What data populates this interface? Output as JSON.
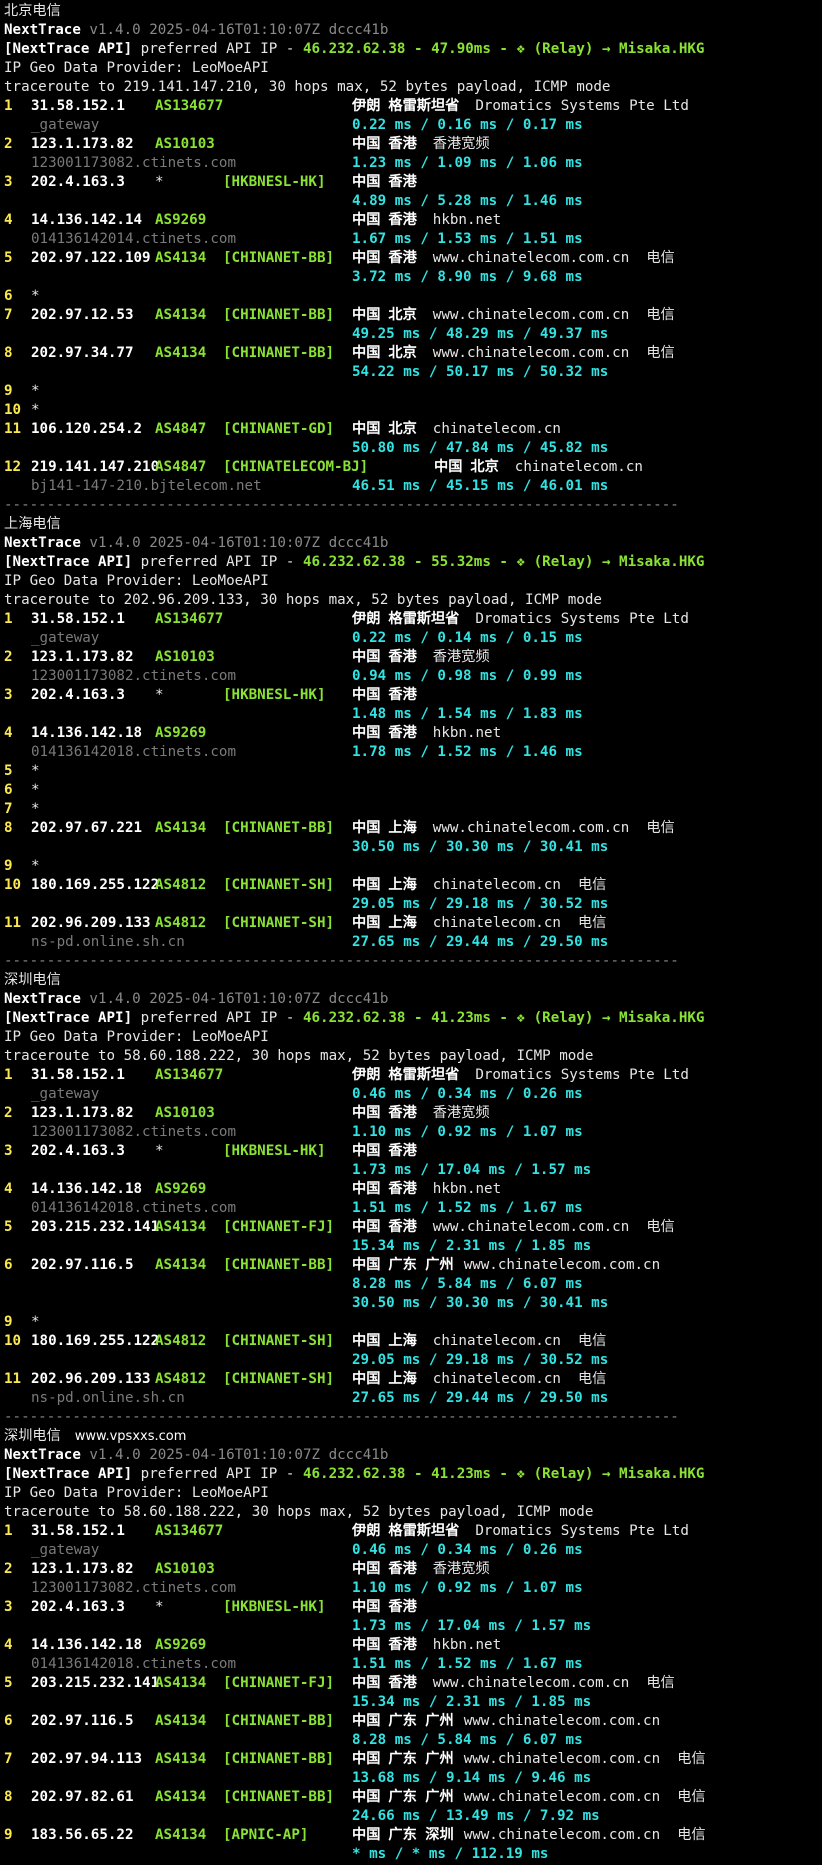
{
  "blocks": [
    {
      "title": "北京电信",
      "version": "v1.4.0 2025-04-16T01:10:07Z dccc41b",
      "api_ip": "46.232.62.38",
      "api_ms": "47.90ms",
      "relay": "(Relay) → Misaka.HKG",
      "geo_provider": "IP Geo Data Provider: LeoMoeAPI",
      "traceroute": "traceroute to 219.141.147.210, 30 hops max, 52 bytes payload, ICMP mode",
      "hops": [
        {
          "n": "1",
          "ip": "31.58.152.1",
          "asn": "AS134677",
          "tag": "",
          "country": "伊朗",
          "region": "格雷斯坦省",
          "org": "Dromatics Systems Pte Ltd",
          "host": "_gateway",
          "rtt": "0.22 ms / 0.16 ms / 0.17 ms"
        },
        {
          "n": "2",
          "ip": "123.1.173.82",
          "asn": "AS10103",
          "tag": "",
          "country": "中国",
          "region": "香港",
          "org": "香港宽频",
          "host": "123001173082.ctinets.com",
          "rtt": "1.23 ms / 1.09 ms / 1.06 ms"
        },
        {
          "n": "3",
          "ip": "202.4.163.3",
          "asn": "*",
          "tag": "[HKBNESL-HK]",
          "country": "中国",
          "region": "香港",
          "org": "",
          "host": "",
          "rtt": "4.89 ms / 5.28 ms / 1.46 ms"
        },
        {
          "n": "4",
          "ip": "14.136.142.14",
          "asn": "AS9269",
          "tag": "",
          "country": "中国",
          "region": "香港",
          "org": "hkbn.net",
          "host": "014136142014.ctinets.com",
          "rtt": "1.67 ms / 1.53 ms / 1.51 ms"
        },
        {
          "n": "5",
          "ip": "202.97.122.109",
          "asn": "AS4134",
          "tag": "[CHINANET-BB]",
          "country": "中国",
          "region": "香港",
          "org": "www.chinatelecom.com.cn  电信",
          "host": "",
          "rtt": "3.72 ms / 8.90 ms / 9.68 ms"
        },
        {
          "n": "6",
          "ip": "*",
          "star": true
        },
        {
          "n": "7",
          "ip": "202.97.12.53",
          "asn": "AS4134",
          "tag": "[CHINANET-BB]",
          "country": "中国",
          "region": "北京",
          "org": "www.chinatelecom.com.cn  电信",
          "host": "",
          "rtt": "49.25 ms / 48.29 ms / 49.37 ms"
        },
        {
          "n": "8",
          "ip": "202.97.34.77",
          "asn": "AS4134",
          "tag": "[CHINANET-BB]",
          "country": "中国",
          "region": "北京",
          "org": "www.chinatelecom.com.cn  电信",
          "host": "",
          "rtt": "54.22 ms / 50.17 ms / 50.32 ms"
        },
        {
          "n": "9",
          "ip": "*",
          "star": true
        },
        {
          "n": "10",
          "ip": "*",
          "star": true
        },
        {
          "n": "11",
          "ip": "106.120.254.2",
          "asn": "AS4847",
          "tag": "[CHINANET-GD]",
          "country": "中国",
          "region": "北京",
          "org": "chinatelecom.cn",
          "host": "",
          "rtt": "50.80 ms / 47.84 ms / 45.82 ms"
        },
        {
          "n": "12",
          "ip": "219.141.147.210",
          "asn": "AS4847",
          "tag": "[CHINATELECOM-BJ]",
          "country": "中国",
          "region": "北京",
          "org": "chinatelecom.cn",
          "host": "bj141-147-210.bjtelecom.net",
          "rtt": "46.51 ms / 45.15 ms / 46.01 ms",
          "shift": true
        }
      ]
    },
    {
      "title": "上海电信",
      "version": "v1.4.0 2025-04-16T01:10:07Z dccc41b",
      "api_ip": "46.232.62.38",
      "api_ms": "55.32ms",
      "relay": "(Relay) → Misaka.HKG",
      "geo_provider": "IP Geo Data Provider: LeoMoeAPI",
      "traceroute": "traceroute to 202.96.209.133, 30 hops max, 52 bytes payload, ICMP mode",
      "hops": [
        {
          "n": "1",
          "ip": "31.58.152.1",
          "asn": "AS134677",
          "tag": "",
          "country": "伊朗",
          "region": "格雷斯坦省",
          "org": "Dromatics Systems Pte Ltd",
          "host": "_gateway",
          "rtt": "0.22 ms / 0.14 ms / 0.15 ms"
        },
        {
          "n": "2",
          "ip": "123.1.173.82",
          "asn": "AS10103",
          "tag": "",
          "country": "中国",
          "region": "香港",
          "org": "香港宽频",
          "host": "123001173082.ctinets.com",
          "rtt": "0.94 ms / 0.98 ms / 0.99 ms"
        },
        {
          "n": "3",
          "ip": "202.4.163.3",
          "asn": "*",
          "tag": "[HKBNESL-HK]",
          "country": "中国",
          "region": "香港",
          "org": "",
          "host": "",
          "rtt": "1.48 ms / 1.54 ms / 1.83 ms"
        },
        {
          "n": "4",
          "ip": "14.136.142.18",
          "asn": "AS9269",
          "tag": "",
          "country": "中国",
          "region": "香港",
          "org": "hkbn.net",
          "host": "014136142018.ctinets.com",
          "rtt": "1.78 ms / 1.52 ms / 1.46 ms"
        },
        {
          "n": "5",
          "ip": "*",
          "star": true
        },
        {
          "n": "6",
          "ip": "*",
          "star": true
        },
        {
          "n": "7",
          "ip": "*",
          "star": true
        },
        {
          "n": "8",
          "ip": "202.97.67.221",
          "asn": "AS4134",
          "tag": "[CHINANET-BB]",
          "country": "中国",
          "region": "上海",
          "org": "www.chinatelecom.com.cn  电信",
          "host": "",
          "rtt": "30.50 ms / 30.30 ms / 30.41 ms"
        },
        {
          "n": "9",
          "ip": "*",
          "star": true
        },
        {
          "n": "10",
          "ip": "180.169.255.122",
          "asn": "AS4812",
          "tag": "[CHINANET-SH]",
          "country": "中国",
          "region": "上海",
          "org": "chinatelecom.cn  电信",
          "host": "",
          "rtt": "29.05 ms / 29.18 ms / 30.52 ms"
        },
        {
          "n": "11",
          "ip": "202.96.209.133",
          "asn": "AS4812",
          "tag": "[CHINANET-SH]",
          "country": "中国",
          "region": "上海",
          "org": "chinatelecom.cn  电信",
          "host": "ns-pd.online.sh.cn",
          "rtt": "27.65 ms / 29.44 ms / 29.50 ms"
        }
      ]
    },
    {
      "title": "深圳电信",
      "version": "v1.4.0 2025-04-16T01:10:07Z dccc41b",
      "api_ip": "46.232.62.38",
      "api_ms": "41.23ms",
      "relay": "(Relay) → Misaka.HKG",
      "geo_provider": "IP Geo Data Provider: LeoMoeAPI",
      "traceroute": "traceroute to 58.60.188.222, 30 hops max, 52 bytes payload, ICMP mode",
      "hops": [
        {
          "n": "1",
          "ip": "31.58.152.1",
          "asn": "AS134677",
          "tag": "",
          "country": "伊朗",
          "region": "格雷斯坦省",
          "org": "Dromatics Systems Pte Ltd",
          "host": "_gateway",
          "rtt": "0.46 ms / 0.34 ms / 0.26 ms"
        },
        {
          "n": "2",
          "ip": "123.1.173.82",
          "asn": "AS10103",
          "tag": "",
          "country": "中国",
          "region": "香港",
          "org": "香港宽频",
          "host": "123001173082.ctinets.com",
          "rtt": "1.10 ms / 0.92 ms / 1.07 ms"
        },
        {
          "n": "3",
          "ip": "202.4.163.3",
          "asn": "*",
          "tag": "[HKBNESL-HK]",
          "country": "中国",
          "region": "香港",
          "org": "",
          "host": "",
          "rtt": "1.73 ms / 17.04 ms / 1.57 ms"
        },
        {
          "n": "4",
          "ip": "14.136.142.18",
          "asn": "AS9269",
          "tag": "",
          "country": "中国",
          "region": "香港",
          "org": "hkbn.net",
          "host": "014136142018.ctinets.com",
          "rtt": "1.51 ms / 1.52 ms / 1.67 ms"
        },
        {
          "n": "5",
          "ip": "203.215.232.141",
          "asn": "AS4134",
          "tag": "[CHINANET-FJ]",
          "country": "中国",
          "region": "香港",
          "org": "www.chinatelecom.com.cn  电信",
          "host": "",
          "rtt": "15.34 ms / 2.31 ms / 1.85 ms"
        },
        {
          "n": "6",
          "ip": "202.97.116.5",
          "asn": "AS4134",
          "tag": "[CHINANET-BB]",
          "country": "中国",
          "region": "广东 广州",
          "org": "www.chinatelecom.com.cn",
          "host": "",
          "rtt": "8.28 ms / 5.84 ms / 6.07 ms",
          "rtt2": "30.50 ms / 30.30 ms / 30.41 ms",
          "orgtight": true
        },
        {
          "n": "9",
          "ip": "*",
          "star": true
        },
        {
          "n": "10",
          "ip": "180.169.255.122",
          "asn": "AS4812",
          "tag": "[CHINANET-SH]",
          "country": "中国",
          "region": "上海",
          "org": "chinatelecom.cn  电信",
          "host": "",
          "rtt": "29.05 ms / 29.18 ms / 30.52 ms"
        },
        {
          "n": "11",
          "ip": "202.96.209.133",
          "asn": "AS4812",
          "tag": "[CHINANET-SH]",
          "country": "中国",
          "region": "上海",
          "org": "chinatelecom.cn  电信",
          "host": "ns-pd.online.sh.cn",
          "rtt": "27.65 ms / 29.44 ms / 29.50 ms"
        }
      ]
    },
    {
      "title": "深圳电信",
      "watermark": "www.vpsxxs.com",
      "version": "v1.4.0 2025-04-16T01:10:07Z dccc41b",
      "api_ip": "46.232.62.38",
      "api_ms": "41.23ms",
      "relay": "(Relay) → Misaka.HKG",
      "geo_provider": "IP Geo Data Provider: LeoMoeAPI",
      "traceroute": "traceroute to 58.60.188.222, 30 hops max, 52 bytes payload, ICMP mode",
      "hops": [
        {
          "n": "1",
          "ip": "31.58.152.1",
          "asn": "AS134677",
          "tag": "",
          "country": "伊朗",
          "region": "格雷斯坦省",
          "org": "Dromatics Systems Pte Ltd",
          "host": "_gateway",
          "rtt": "0.46 ms / 0.34 ms / 0.26 ms"
        },
        {
          "n": "2",
          "ip": "123.1.173.82",
          "asn": "AS10103",
          "tag": "",
          "country": "中国",
          "region": "香港",
          "org": "香港宽频",
          "host": "123001173082.ctinets.com",
          "rtt": "1.10 ms / 0.92 ms / 1.07 ms"
        },
        {
          "n": "3",
          "ip": "202.4.163.3",
          "asn": "*",
          "tag": "[HKBNESL-HK]",
          "country": "中国",
          "region": "香港",
          "org": "",
          "host": "",
          "rtt": "1.73 ms / 17.04 ms / 1.57 ms"
        },
        {
          "n": "4",
          "ip": "14.136.142.18",
          "asn": "AS9269",
          "tag": "",
          "country": "中国",
          "region": "香港",
          "org": "hkbn.net",
          "host": "014136142018.ctinets.com",
          "rtt": "1.51 ms / 1.52 ms / 1.67 ms"
        },
        {
          "n": "5",
          "ip": "203.215.232.141",
          "asn": "AS4134",
          "tag": "[CHINANET-FJ]",
          "country": "中国",
          "region": "香港",
          "org": "www.chinatelecom.com.cn  电信",
          "host": "",
          "rtt": "15.34 ms / 2.31 ms / 1.85 ms"
        },
        {
          "n": "6",
          "ip": "202.97.116.5",
          "asn": "AS4134",
          "tag": "[CHINANET-BB]",
          "country": "中国",
          "region": "广东 广州",
          "org": "www.chinatelecom.com.cn",
          "host": "",
          "rtt": "8.28 ms / 5.84 ms / 6.07 ms",
          "orgtight": true
        },
        {
          "n": "7",
          "ip": "202.97.94.113",
          "asn": "AS4134",
          "tag": "[CHINANET-BB]",
          "country": "中国",
          "region": "广东 广州",
          "org": "www.chinatelecom.com.cn  电信",
          "host": "",
          "rtt": "13.68 ms / 9.14 ms / 9.46 ms",
          "orgtight": true
        },
        {
          "n": "8",
          "ip": "202.97.82.61",
          "asn": "AS4134",
          "tag": "[CHINANET-BB]",
          "country": "中国",
          "region": "广东 广州",
          "org": "www.chinatelecom.com.cn  电信",
          "host": "",
          "rtt": "24.66 ms / 13.49 ms / 7.92 ms",
          "orgtight": true
        },
        {
          "n": "9",
          "ip": "183.56.65.22",
          "asn": "AS4134",
          "tag": "[APNIC-AP]",
          "country": "中国",
          "region": "广东 深圳",
          "org": "www.chinatelecom.com.cn  电信",
          "host": "",
          "rtt": "* ms / * ms / 112.19 ms",
          "orgtight": true
        }
      ]
    }
  ],
  "labels": {
    "app_name": "NextTrace",
    "api_prefix": "[NextTrace API]",
    "api_mid": " preferred API IP - ",
    "dash": " - ",
    "relay_icon": "❖",
    "separator": "-------------------------------------------------------------------------------"
  }
}
